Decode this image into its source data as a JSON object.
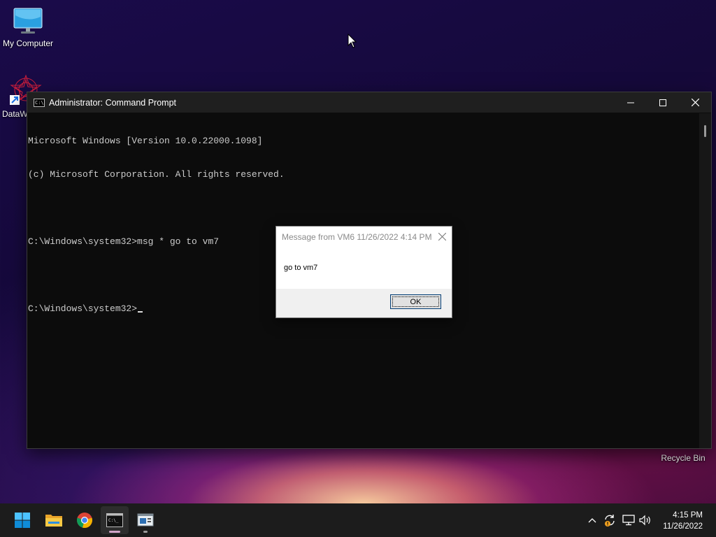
{
  "desktop": {
    "icons": [
      {
        "label": "My Computer"
      },
      {
        "label": "DataW"
      },
      {
        "label": "Recycle Bin"
      }
    ]
  },
  "cmd": {
    "title": "Administrator: Command Prompt",
    "lines": [
      "Microsoft Windows [Version 10.0.22000.1098]",
      "(c) Microsoft Corporation. All rights reserved.",
      "",
      "C:\\Windows\\system32>msg * go to vm7",
      "",
      "C:\\Windows\\system32>"
    ],
    "icon": "cmd-icon"
  },
  "dialog": {
    "title": "Message from VM6 11/26/2022 4:14 PM",
    "message": "go to vm7",
    "ok_label": "OK"
  },
  "taskbar": {
    "apps": [
      "start-icon",
      "file-explorer-icon",
      "chrome-icon",
      "command-prompt-icon",
      "system-info-icon"
    ],
    "clock": {
      "time": "4:15 PM",
      "date": "11/26/2022"
    }
  },
  "colors": {
    "cmd_bg": "#0c0c0c",
    "cmd_text": "#cccccc",
    "taskbar_bg": "#1c1c1c",
    "accent": "#0078d4"
  }
}
